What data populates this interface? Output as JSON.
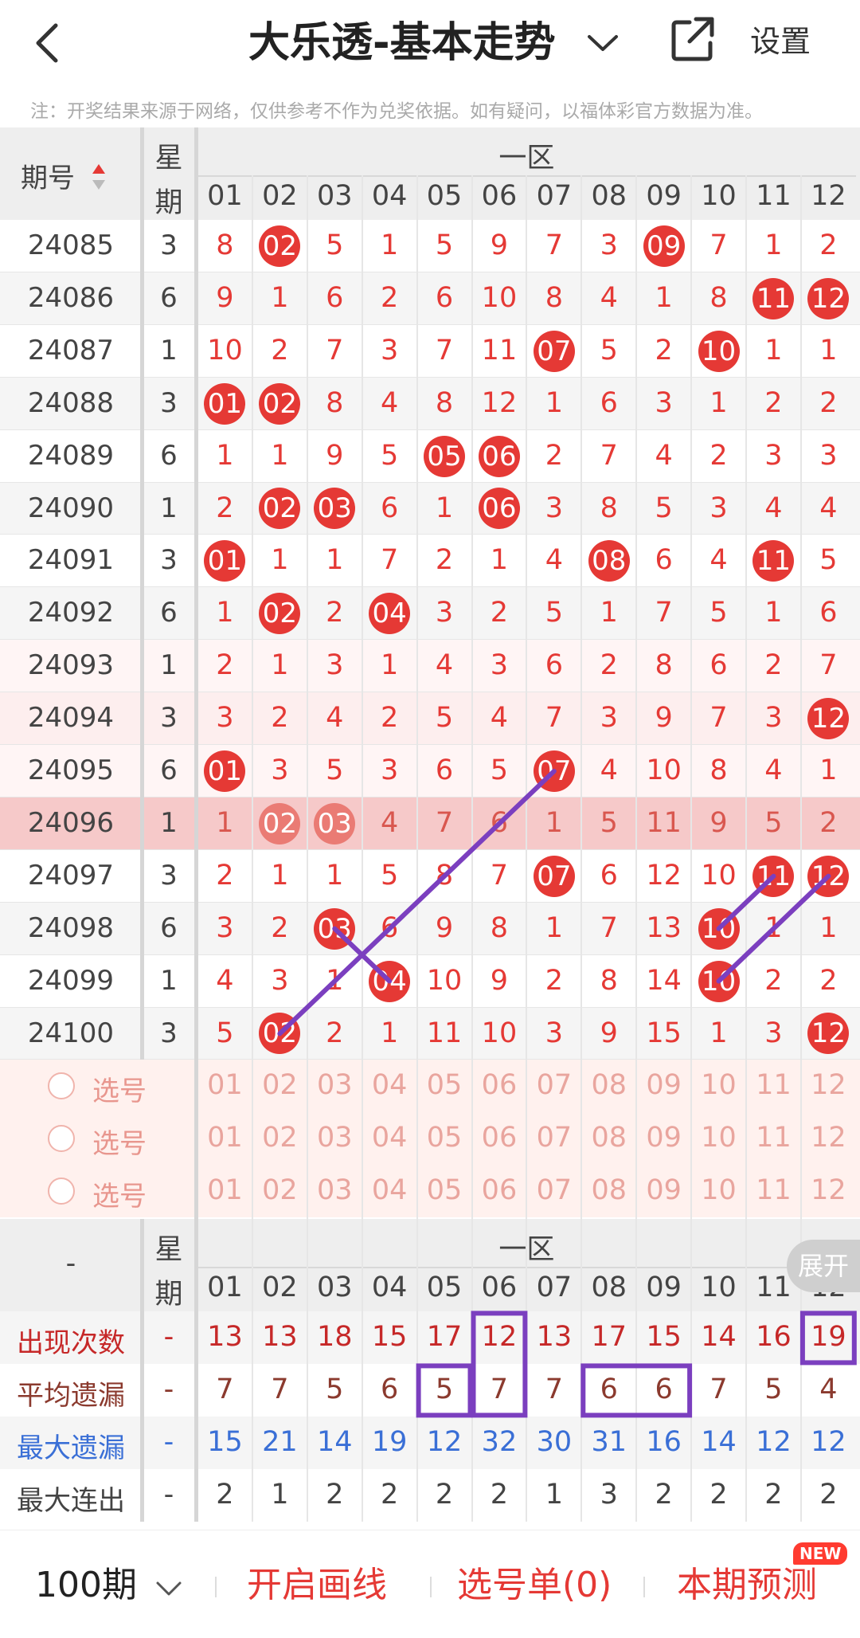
{
  "header": {
    "back_icon": "chevron-left-icon",
    "title": "大乐透-基本走势",
    "dropdown_icon": "chevron-down-icon",
    "share_icon": "share-external-icon",
    "settings_label": "设置"
  },
  "notice": "注：开奖结果来源于网络，仅供参考不作为兑奖依据。如有疑问，以福体彩官方数据为准。",
  "table": {
    "issue_header": "期号",
    "week_header_top": "星",
    "week_header_bottom": "期",
    "zone_header": "一区",
    "columns": [
      "01",
      "02",
      "03",
      "04",
      "05",
      "06",
      "07",
      "08",
      "09",
      "10",
      "11",
      "12"
    ],
    "rows": [
      {
        "issue": "24085",
        "week": "3",
        "cells": [
          "8",
          "02",
          "5",
          "1",
          "5",
          "9",
          "7",
          "3",
          "09",
          "7",
          "1",
          "2"
        ],
        "hits": [
          2,
          9
        ]
      },
      {
        "issue": "24086",
        "week": "6",
        "cells": [
          "9",
          "1",
          "6",
          "2",
          "6",
          "10",
          "8",
          "4",
          "1",
          "8",
          "11",
          "12"
        ],
        "hits": [
          11,
          12
        ]
      },
      {
        "issue": "24087",
        "week": "1",
        "cells": [
          "10",
          "2",
          "7",
          "3",
          "7",
          "11",
          "07",
          "5",
          "2",
          "10",
          "1",
          "1"
        ],
        "hits": [
          7,
          10
        ]
      },
      {
        "issue": "24088",
        "week": "3",
        "cells": [
          "01",
          "02",
          "8",
          "4",
          "8",
          "12",
          "1",
          "6",
          "3",
          "1",
          "2",
          "2"
        ],
        "hits": [
          1,
          2
        ]
      },
      {
        "issue": "24089",
        "week": "6",
        "cells": [
          "1",
          "1",
          "9",
          "5",
          "05",
          "06",
          "2",
          "7",
          "4",
          "2",
          "3",
          "3"
        ],
        "hits": [
          5,
          6
        ]
      },
      {
        "issue": "24090",
        "week": "1",
        "cells": [
          "2",
          "02",
          "03",
          "6",
          "1",
          "06",
          "3",
          "8",
          "5",
          "3",
          "4",
          "4"
        ],
        "hits": [
          2,
          3,
          6
        ]
      },
      {
        "issue": "24091",
        "week": "3",
        "cells": [
          "01",
          "1",
          "1",
          "7",
          "2",
          "1",
          "4",
          "08",
          "6",
          "4",
          "11",
          "5"
        ],
        "hits": [
          1,
          8,
          11
        ]
      },
      {
        "issue": "24092",
        "week": "6",
        "cells": [
          "1",
          "02",
          "2",
          "04",
          "3",
          "2",
          "5",
          "1",
          "7",
          "5",
          "1",
          "6"
        ],
        "hits": [
          2,
          4
        ]
      },
      {
        "issue": "24093",
        "week": "1",
        "cells": [
          "2",
          "1",
          "3",
          "1",
          "4",
          "3",
          "6",
          "2",
          "8",
          "6",
          "2",
          "7"
        ],
        "hits": []
      },
      {
        "issue": "24094",
        "week": "3",
        "cells": [
          "3",
          "2",
          "4",
          "2",
          "5",
          "4",
          "7",
          "3",
          "9",
          "7",
          "3",
          "12"
        ],
        "hits": [
          12
        ]
      },
      {
        "issue": "24095",
        "week": "6",
        "cells": [
          "01",
          "3",
          "5",
          "3",
          "6",
          "5",
          "07",
          "4",
          "10",
          "8",
          "4",
          "1"
        ],
        "hits": [
          1,
          7
        ]
      },
      {
        "issue": "24096",
        "week": "1",
        "cells": [
          "1",
          "02",
          "03",
          "4",
          "7",
          "6",
          "1",
          "5",
          "11",
          "9",
          "5",
          "2"
        ],
        "hits": [
          2,
          3
        ],
        "highlight": true
      },
      {
        "issue": "24097",
        "week": "3",
        "cells": [
          "2",
          "1",
          "1",
          "5",
          "8",
          "7",
          "07",
          "6",
          "12",
          "10",
          "11",
          "12"
        ],
        "hits": [
          7,
          11,
          12
        ]
      },
      {
        "issue": "24098",
        "week": "6",
        "cells": [
          "3",
          "2",
          "03",
          "6",
          "9",
          "8",
          "1",
          "7",
          "13",
          "10",
          "1",
          "1"
        ],
        "hits": [
          3,
          10
        ]
      },
      {
        "issue": "24099",
        "week": "1",
        "cells": [
          "4",
          "3",
          "1",
          "04",
          "10",
          "9",
          "2",
          "8",
          "14",
          "10",
          "2",
          "2"
        ],
        "hits": [
          4,
          10
        ]
      },
      {
        "issue": "24100",
        "week": "3",
        "cells": [
          "5",
          "02",
          "2",
          "1",
          "11",
          "10",
          "3",
          "9",
          "15",
          "1",
          "3",
          "12"
        ],
        "hits": [
          2,
          12
        ]
      }
    ],
    "pick_rows": [
      {
        "label": "选号"
      },
      {
        "label": "选号"
      },
      {
        "label": "选号"
      }
    ]
  },
  "stats": {
    "dash": "-",
    "week_top": "星",
    "week_bottom": "期",
    "zone_header": "一区",
    "columns": [
      "01",
      "02",
      "03",
      "04",
      "05",
      "06",
      "07",
      "08",
      "09",
      "10",
      "11",
      "12"
    ],
    "expand_label": "展开",
    "rows": [
      {
        "label": "出现次数",
        "color": "#c62828",
        "values": [
          "13",
          "13",
          "18",
          "15",
          "17",
          "12",
          "13",
          "17",
          "15",
          "14",
          "16",
          "19"
        ]
      },
      {
        "label": "平均遗漏",
        "color": "#8b3a2e",
        "values": [
          "7",
          "7",
          "5",
          "6",
          "5",
          "7",
          "7",
          "6",
          "6",
          "7",
          "5",
          "4"
        ]
      },
      {
        "label": "最大遗漏",
        "color": "#3a6fd6",
        "values": [
          "15",
          "21",
          "14",
          "19",
          "12",
          "32",
          "30",
          "31",
          "16",
          "14",
          "12",
          "12"
        ]
      },
      {
        "label": "最大连出",
        "color": "#444444",
        "values": [
          "2",
          "1",
          "2",
          "2",
          "2",
          "2",
          "1",
          "3",
          "2",
          "2",
          "2",
          "2"
        ]
      }
    ]
  },
  "footer": {
    "period_label": "100期",
    "period_icon": "chevron-down-icon",
    "draw_line_label": "开启画线",
    "pick_list_label": "选号单(0)",
    "predict_label": "本期预测",
    "new_badge": "NEW"
  },
  "colors": {
    "red": "#e53935",
    "purple": "#7b3fbf",
    "blue": "#3a6fd6",
    "highlight_row": "#f6c9c9",
    "pick_bg": "#fff1ee"
  }
}
